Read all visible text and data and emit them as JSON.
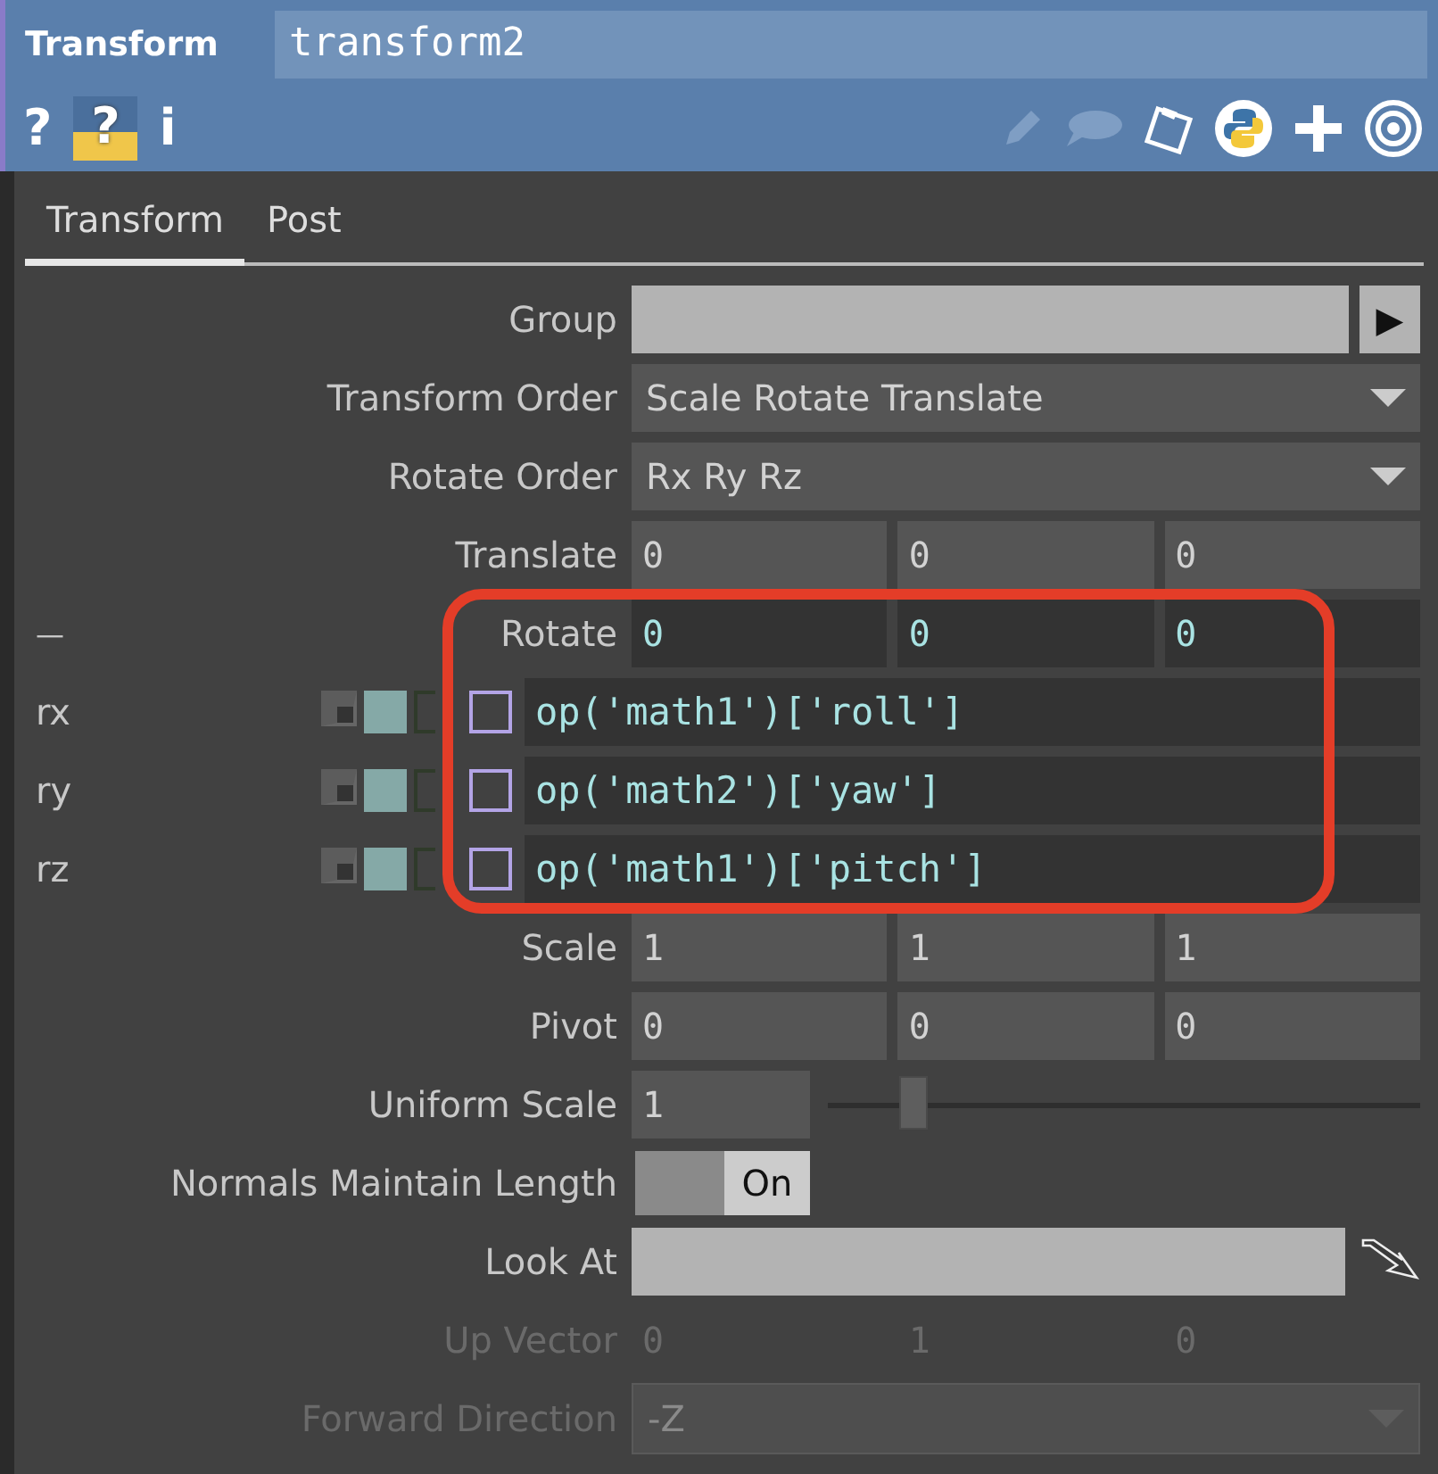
{
  "header": {
    "title": "Transform",
    "name": "transform2",
    "tool_glyphs": [
      "?",
      "?",
      "i"
    ]
  },
  "tabs": [
    {
      "label": "Transform",
      "selected": true
    },
    {
      "label": "Post",
      "selected": false
    }
  ],
  "params": [
    {
      "kind": "operator",
      "label": "Group",
      "disabled": false,
      "button": "▶"
    },
    {
      "kind": "dropdown",
      "label": "Transform Order",
      "disabled": false,
      "value": "Scale Rotate Translate"
    },
    {
      "kind": "dropdown",
      "label": "Rotate Order",
      "disabled": false,
      "value": "Rx Ry Rz"
    },
    {
      "kind": "vector",
      "label": "Translate",
      "disabled": false,
      "values": [
        "0",
        "0",
        "0"
      ]
    },
    {
      "kind": "expr-vector",
      "prefix": "—",
      "label": "Rotate",
      "disabled": false,
      "values": [
        "0",
        "0",
        "0"
      ]
    },
    {
      "kind": "channel",
      "name": "rx",
      "checked": false,
      "expression": "op('math1')['roll']"
    },
    {
      "kind": "channel",
      "name": "ry",
      "checked": false,
      "expression": "op('math2')['yaw']"
    },
    {
      "kind": "channel",
      "name": "rz",
      "checked": false,
      "expression": "op('math1')['pitch']"
    },
    {
      "kind": "vector",
      "label": "Scale",
      "disabled": false,
      "values": [
        "1",
        "1",
        "1"
      ]
    },
    {
      "kind": "vector",
      "label": "Pivot",
      "disabled": false,
      "values": [
        "0",
        "0",
        "0"
      ]
    },
    {
      "kind": "slider",
      "label": "Uniform Scale",
      "disabled": false,
      "value": "1",
      "level": 0.12
    },
    {
      "kind": "toggle",
      "label": "Normals Maintain Length",
      "disabled": false,
      "on": true,
      "state_text": "On"
    },
    {
      "kind": "operator",
      "label": "Look At",
      "disabled": false
    },
    {
      "kind": "vector",
      "label": "Up Vector",
      "disabled": true,
      "values": [
        "0",
        "1",
        "0"
      ]
    },
    {
      "kind": "dropdown",
      "label": "Forward Direction",
      "disabled": true,
      "value": "-Z"
    }
  ]
}
